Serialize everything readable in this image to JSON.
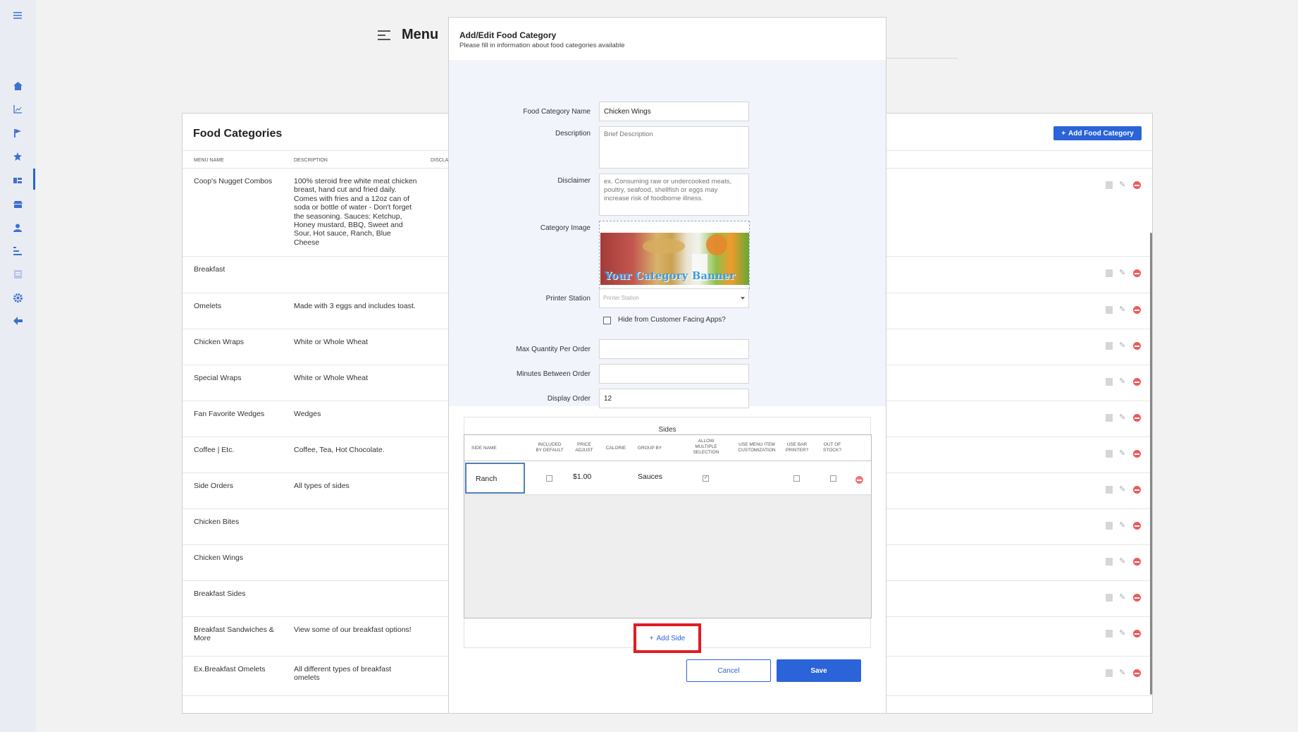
{
  "page": {
    "title": "Menu"
  },
  "rail": {
    "icons": [
      "menu-icon",
      "home-icon",
      "chart-icon",
      "flag-icon",
      "star-icon",
      "list-icon",
      "store-icon",
      "user-icon",
      "sort-icon",
      "report-icon",
      "settings-icon",
      "back-arrow-icon"
    ]
  },
  "card": {
    "title": "Food Categories",
    "add_button": "Add Food Category",
    "columns": [
      "MENU NAME",
      "DESCRIPTION",
      "DISCLA"
    ],
    "rows": [
      {
        "name": "Coop's Nugget Combos",
        "description": "100% steroid free white meat chicken breast, hand cut and fried daily. Comes with fries and a 12oz can of soda or bottle of water - Don't forget the seasoning. Sauces: Ketchup, Honey mustard, BBQ, Sweet and Sour, Hot sauce, Ranch, Blue Cheese"
      },
      {
        "name": "Breakfast",
        "description": ""
      },
      {
        "name": "Omelets",
        "description": "Made with 3 eggs and includes toast."
      },
      {
        "name": "Chicken Wraps",
        "description": "White or Whole Wheat"
      },
      {
        "name": "Special Wraps",
        "description": "White or Whole Wheat"
      },
      {
        "name": "Fan Favorite Wedges",
        "description": "Wedges"
      },
      {
        "name": "Coffee | Etc.",
        "description": "Coffee, Tea, Hot Chocolate."
      },
      {
        "name": "Side Orders",
        "description": "All types of sides"
      },
      {
        "name": "Chicken Bites",
        "description": ""
      },
      {
        "name": "Chicken Wings",
        "description": ""
      },
      {
        "name": "Breakfast Sides",
        "description": ""
      },
      {
        "name": "Breakfast Sandwiches & More",
        "description": "View some of our breakfast options!"
      },
      {
        "name": "Ex.Breakfast Omelets",
        "description": "All different types of breakfast omelets"
      }
    ]
  },
  "modal": {
    "title": "Add/Edit Food Category",
    "subtitle": "Please fill in information about food categories available",
    "fields": {
      "name_label": "Food Category Name",
      "name_value": "Chicken Wings",
      "description_label": "Description",
      "description_placeholder": "Brief Description",
      "disclaimer_label": "Disclaimer",
      "disclaimer_placeholder": "ex. Consuming raw or undercooked meats, poultry, seafood, shellfish or eggs may increase risk of foodborne illness.",
      "image_label": "Category Image",
      "image_banner_text": "Your Category Banner",
      "printer_label": "Printer Station",
      "printer_placeholder": "Printer Station",
      "hide_label": "Hide from Customer Facing Apps?",
      "hide_checked": false,
      "max_qty_label": "Max Quantity Per Order",
      "max_qty_value": "",
      "minutes_label": "Minutes Between Order",
      "minutes_value": "",
      "display_order_label": "Display Order",
      "display_order_value": "12"
    },
    "sides": {
      "title": "Sides",
      "columns": [
        "SIDE NAME",
        "INCLUDED BY DEFAULT",
        "PRICE ADJUST",
        "CALORIE",
        "GROUP BY",
        "ALLOW MULTIPLE SELECTION",
        "USE MENU ITEM CUSTOMIZATION",
        "USE BAR PRINTER?",
        "OUT OF STOCK?"
      ],
      "rows": [
        {
          "side_name": "Ranch",
          "included_by_default": false,
          "price_adjust": "$1.00",
          "calorie": "",
          "group_by": "Sauces",
          "allow_multiple": true,
          "use_bar_printer": false,
          "out_of_stock": false
        }
      ],
      "add_label": "Add Side"
    },
    "cancel_label": "Cancel",
    "save_label": "Save"
  },
  "colors": {
    "accent": "#2b63d9",
    "danger": "#f05a5a",
    "highlight": "#e11b22"
  }
}
